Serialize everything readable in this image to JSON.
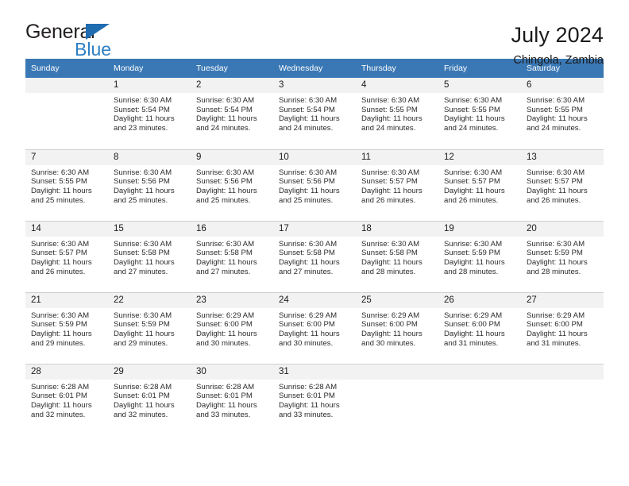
{
  "logo": {
    "word_top": "General",
    "word_bottom": "Blue",
    "triangle_icon": "triangle-icon",
    "colors": {
      "dark": "#231f20",
      "blue": "#2b7fc4",
      "triangle": "#1f6cb0"
    }
  },
  "header": {
    "title": "July 2024",
    "subtitle": "Chingola, Zambia"
  },
  "theme": {
    "header_band": "#3a78b5",
    "daynum_band": "#f2f2f2",
    "grid_line": "#cfcfcf",
    "text": "#1a1a1a"
  },
  "weekday_headers": [
    "Sunday",
    "Monday",
    "Tuesday",
    "Wednesday",
    "Thursday",
    "Friday",
    "Saturday"
  ],
  "weeks": [
    [
      {
        "day": "",
        "empty": true
      },
      {
        "day": "1",
        "sunrise": "Sunrise: 6:30 AM",
        "sunset": "Sunset: 5:54 PM",
        "daylight": "Daylight: 11 hours and 23 minutes."
      },
      {
        "day": "2",
        "sunrise": "Sunrise: 6:30 AM",
        "sunset": "Sunset: 5:54 PM",
        "daylight": "Daylight: 11 hours and 24 minutes."
      },
      {
        "day": "3",
        "sunrise": "Sunrise: 6:30 AM",
        "sunset": "Sunset: 5:54 PM",
        "daylight": "Daylight: 11 hours and 24 minutes."
      },
      {
        "day": "4",
        "sunrise": "Sunrise: 6:30 AM",
        "sunset": "Sunset: 5:55 PM",
        "daylight": "Daylight: 11 hours and 24 minutes."
      },
      {
        "day": "5",
        "sunrise": "Sunrise: 6:30 AM",
        "sunset": "Sunset: 5:55 PM",
        "daylight": "Daylight: 11 hours and 24 minutes."
      },
      {
        "day": "6",
        "sunrise": "Sunrise: 6:30 AM",
        "sunset": "Sunset: 5:55 PM",
        "daylight": "Daylight: 11 hours and 24 minutes."
      }
    ],
    [
      {
        "day": "7",
        "sunrise": "Sunrise: 6:30 AM",
        "sunset": "Sunset: 5:55 PM",
        "daylight": "Daylight: 11 hours and 25 minutes."
      },
      {
        "day": "8",
        "sunrise": "Sunrise: 6:30 AM",
        "sunset": "Sunset: 5:56 PM",
        "daylight": "Daylight: 11 hours and 25 minutes."
      },
      {
        "day": "9",
        "sunrise": "Sunrise: 6:30 AM",
        "sunset": "Sunset: 5:56 PM",
        "daylight": "Daylight: 11 hours and 25 minutes."
      },
      {
        "day": "10",
        "sunrise": "Sunrise: 6:30 AM",
        "sunset": "Sunset: 5:56 PM",
        "daylight": "Daylight: 11 hours and 25 minutes."
      },
      {
        "day": "11",
        "sunrise": "Sunrise: 6:30 AM",
        "sunset": "Sunset: 5:57 PM",
        "daylight": "Daylight: 11 hours and 26 minutes."
      },
      {
        "day": "12",
        "sunrise": "Sunrise: 6:30 AM",
        "sunset": "Sunset: 5:57 PM",
        "daylight": "Daylight: 11 hours and 26 minutes."
      },
      {
        "day": "13",
        "sunrise": "Sunrise: 6:30 AM",
        "sunset": "Sunset: 5:57 PM",
        "daylight": "Daylight: 11 hours and 26 minutes."
      }
    ],
    [
      {
        "day": "14",
        "sunrise": "Sunrise: 6:30 AM",
        "sunset": "Sunset: 5:57 PM",
        "daylight": "Daylight: 11 hours and 26 minutes."
      },
      {
        "day": "15",
        "sunrise": "Sunrise: 6:30 AM",
        "sunset": "Sunset: 5:58 PM",
        "daylight": "Daylight: 11 hours and 27 minutes."
      },
      {
        "day": "16",
        "sunrise": "Sunrise: 6:30 AM",
        "sunset": "Sunset: 5:58 PM",
        "daylight": "Daylight: 11 hours and 27 minutes."
      },
      {
        "day": "17",
        "sunrise": "Sunrise: 6:30 AM",
        "sunset": "Sunset: 5:58 PM",
        "daylight": "Daylight: 11 hours and 27 minutes."
      },
      {
        "day": "18",
        "sunrise": "Sunrise: 6:30 AM",
        "sunset": "Sunset: 5:58 PM",
        "daylight": "Daylight: 11 hours and 28 minutes."
      },
      {
        "day": "19",
        "sunrise": "Sunrise: 6:30 AM",
        "sunset": "Sunset: 5:59 PM",
        "daylight": "Daylight: 11 hours and 28 minutes."
      },
      {
        "day": "20",
        "sunrise": "Sunrise: 6:30 AM",
        "sunset": "Sunset: 5:59 PM",
        "daylight": "Daylight: 11 hours and 28 minutes."
      }
    ],
    [
      {
        "day": "21",
        "sunrise": "Sunrise: 6:30 AM",
        "sunset": "Sunset: 5:59 PM",
        "daylight": "Daylight: 11 hours and 29 minutes."
      },
      {
        "day": "22",
        "sunrise": "Sunrise: 6:30 AM",
        "sunset": "Sunset: 5:59 PM",
        "daylight": "Daylight: 11 hours and 29 minutes."
      },
      {
        "day": "23",
        "sunrise": "Sunrise: 6:29 AM",
        "sunset": "Sunset: 6:00 PM",
        "daylight": "Daylight: 11 hours and 30 minutes."
      },
      {
        "day": "24",
        "sunrise": "Sunrise: 6:29 AM",
        "sunset": "Sunset: 6:00 PM",
        "daylight": "Daylight: 11 hours and 30 minutes."
      },
      {
        "day": "25",
        "sunrise": "Sunrise: 6:29 AM",
        "sunset": "Sunset: 6:00 PM",
        "daylight": "Daylight: 11 hours and 30 minutes."
      },
      {
        "day": "26",
        "sunrise": "Sunrise: 6:29 AM",
        "sunset": "Sunset: 6:00 PM",
        "daylight": "Daylight: 11 hours and 31 minutes."
      },
      {
        "day": "27",
        "sunrise": "Sunrise: 6:29 AM",
        "sunset": "Sunset: 6:00 PM",
        "daylight": "Daylight: 11 hours and 31 minutes."
      }
    ],
    [
      {
        "day": "28",
        "sunrise": "Sunrise: 6:28 AM",
        "sunset": "Sunset: 6:01 PM",
        "daylight": "Daylight: 11 hours and 32 minutes."
      },
      {
        "day": "29",
        "sunrise": "Sunrise: 6:28 AM",
        "sunset": "Sunset: 6:01 PM",
        "daylight": "Daylight: 11 hours and 32 minutes."
      },
      {
        "day": "30",
        "sunrise": "Sunrise: 6:28 AM",
        "sunset": "Sunset: 6:01 PM",
        "daylight": "Daylight: 11 hours and 33 minutes."
      },
      {
        "day": "31",
        "sunrise": "Sunrise: 6:28 AM",
        "sunset": "Sunset: 6:01 PM",
        "daylight": "Daylight: 11 hours and 33 minutes."
      },
      {
        "day": "",
        "empty": true
      },
      {
        "day": "",
        "empty": true
      },
      {
        "day": "",
        "empty": true
      }
    ]
  ]
}
